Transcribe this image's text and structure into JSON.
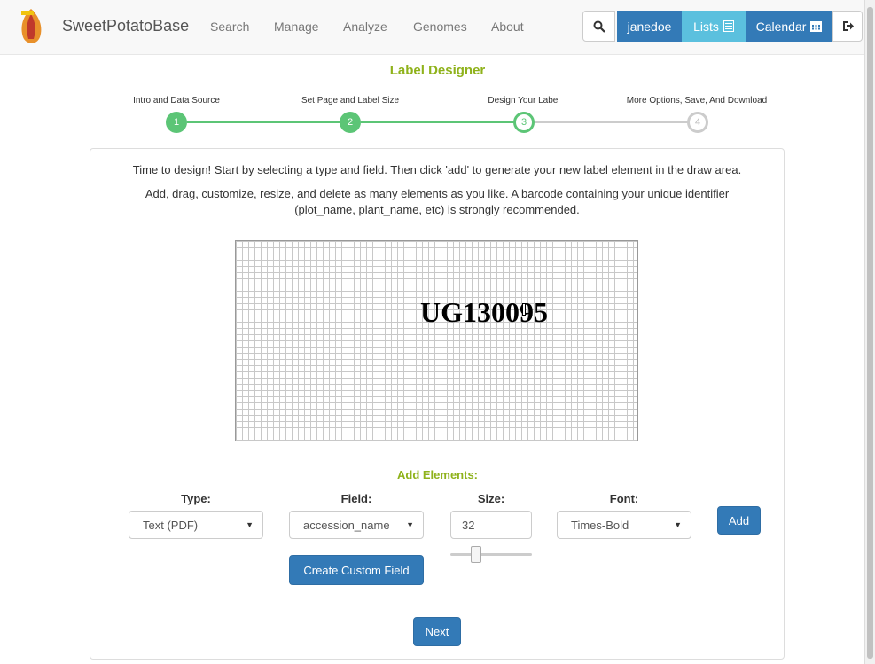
{
  "nav": {
    "brand": "SweetPotatoBase",
    "links": [
      "Search",
      "Manage",
      "Analyze",
      "Genomes",
      "About"
    ],
    "user": "janedoe",
    "lists_label": "Lists",
    "calendar_label": "Calendar",
    "icons": [
      "search-icon",
      "list-icon",
      "calendar-icon",
      "logout-icon"
    ]
  },
  "page_title": "Label Designer",
  "steps": [
    {
      "label": "Intro and Data Source",
      "number": "1",
      "state": "done"
    },
    {
      "label": "Set Page and Label Size",
      "number": "2",
      "state": "done"
    },
    {
      "label": "Design Your Label",
      "number": "3",
      "state": "active"
    },
    {
      "label": "More Options, Save, And Download",
      "number": "4",
      "state": "todo"
    }
  ],
  "instructions": {
    "line1": "Time to design! Start by selecting a type and field. Then click 'add' to generate your new label element in the draw area.",
    "line2a": "Add, drag, customize, resize, and delete as many elements as you like. A barcode containing your unique identifier",
    "line2b": "(plot_name, plant_name, etc) is strongly recommended."
  },
  "draw_area": {
    "element_text": "UG130095"
  },
  "add_elements": {
    "title": "Add Elements:",
    "type_label": "Type:",
    "type_value": "Text (PDF)",
    "field_label": "Field:",
    "field_value": "accession_name",
    "size_label": "Size:",
    "size_value": "32",
    "font_label": "Font:",
    "font_value": "Times-Bold",
    "add_button": "Add",
    "custom_field_button": "Create Custom Field"
  },
  "next_button": "Next",
  "colors": {
    "accent_green": "#8fb21b",
    "step_green": "#5cc576",
    "primary_blue": "#337ab7",
    "info_blue": "#5bc0de"
  }
}
